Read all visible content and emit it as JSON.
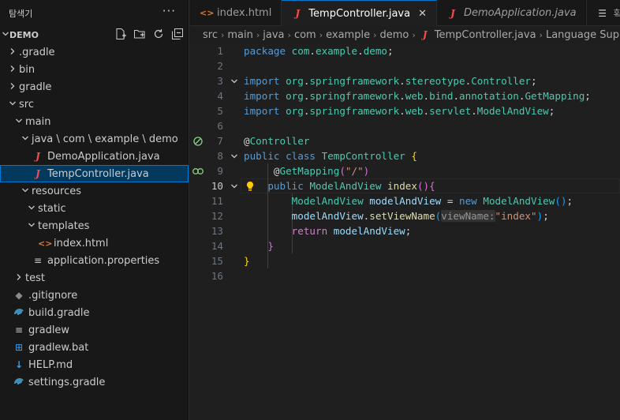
{
  "sidebar": {
    "title": "탐색기",
    "more": "···",
    "project": "DEMO",
    "tree": [
      {
        "label": ".gradle",
        "kind": "folder",
        "level": 0,
        "open": false
      },
      {
        "label": "bin",
        "kind": "folder",
        "level": 0,
        "open": false
      },
      {
        "label": "gradle",
        "kind": "folder",
        "level": 0,
        "open": false
      },
      {
        "label": "src",
        "kind": "folder",
        "level": 0,
        "open": true
      },
      {
        "label": "main",
        "kind": "folder",
        "level": 1,
        "open": true
      },
      {
        "label": "java \\ com \\ example \\ demo",
        "kind": "folder",
        "level": 2,
        "open": true
      },
      {
        "label": "DemoApplication.java",
        "kind": "java",
        "level": 3
      },
      {
        "label": "TempController.java",
        "kind": "java",
        "level": 3,
        "selected": true
      },
      {
        "label": "resources",
        "kind": "folder",
        "level": 2,
        "open": true
      },
      {
        "label": "static",
        "kind": "folder",
        "level": 3,
        "open": true
      },
      {
        "label": "templates",
        "kind": "folder",
        "level": 3,
        "open": true
      },
      {
        "label": "index.html",
        "kind": "html",
        "level": 4
      },
      {
        "label": "application.properties",
        "kind": "props",
        "level": 3
      },
      {
        "label": "test",
        "kind": "folder",
        "level": 1,
        "open": false
      },
      {
        "label": ".gitignore",
        "kind": "git",
        "level": 0
      },
      {
        "label": "build.gradle",
        "kind": "gradle",
        "level": 0
      },
      {
        "label": "gradlew",
        "kind": "plain",
        "level": 0
      },
      {
        "label": "gradlew.bat",
        "kind": "win",
        "level": 0
      },
      {
        "label": "HELP.md",
        "kind": "md",
        "level": 0
      },
      {
        "label": "settings.gradle",
        "kind": "gradle",
        "level": 0
      }
    ]
  },
  "tabs": [
    {
      "label": "index.html",
      "kind": "html",
      "active": false
    },
    {
      "label": "TempController.java",
      "kind": "java",
      "active": true,
      "close": "✕"
    },
    {
      "label": "DemoApplication.java",
      "kind": "java",
      "active": false,
      "italic": true
    },
    {
      "label": "확장:",
      "kind": "ext",
      "active": false
    }
  ],
  "breadcrumb": [
    "src",
    "main",
    "java",
    "com",
    "example",
    "demo",
    "TempController.java",
    "Language Support"
  ],
  "editor": {
    "current_line": 10,
    "lines": [
      {
        "n": "1",
        "tokens": [
          [
            "kw",
            "package"
          ],
          [
            "pl",
            " "
          ],
          [
            "ty",
            "com"
          ],
          [
            "pl",
            "."
          ],
          [
            "ty",
            "example"
          ],
          [
            "pl",
            "."
          ],
          [
            "ty",
            "demo"
          ],
          [
            "pl",
            ";"
          ]
        ]
      },
      {
        "n": "2",
        "tokens": []
      },
      {
        "n": "3",
        "fold": true,
        "tokens": [
          [
            "kw",
            "import"
          ],
          [
            "pl",
            " "
          ],
          [
            "ty",
            "org"
          ],
          [
            "pl",
            "."
          ],
          [
            "ty",
            "springframework"
          ],
          [
            "pl",
            "."
          ],
          [
            "ty",
            "stereotype"
          ],
          [
            "pl",
            "."
          ],
          [
            "ty",
            "Controller"
          ],
          [
            "pl",
            ";"
          ]
        ]
      },
      {
        "n": "4",
        "tokens": [
          [
            "kw",
            "import"
          ],
          [
            "pl",
            " "
          ],
          [
            "ty",
            "org"
          ],
          [
            "pl",
            "."
          ],
          [
            "ty",
            "springframework"
          ],
          [
            "pl",
            "."
          ],
          [
            "ty",
            "web"
          ],
          [
            "pl",
            "."
          ],
          [
            "ty",
            "bind"
          ],
          [
            "pl",
            "."
          ],
          [
            "ty",
            "annotation"
          ],
          [
            "pl",
            "."
          ],
          [
            "ty",
            "GetMapping"
          ],
          [
            "pl",
            ";"
          ]
        ]
      },
      {
        "n": "5",
        "tokens": [
          [
            "kw",
            "import"
          ],
          [
            "pl",
            " "
          ],
          [
            "ty",
            "org"
          ],
          [
            "pl",
            "."
          ],
          [
            "ty",
            "springframework"
          ],
          [
            "pl",
            "."
          ],
          [
            "ty",
            "web"
          ],
          [
            "pl",
            "."
          ],
          [
            "ty",
            "servlet"
          ],
          [
            "pl",
            "."
          ],
          [
            "ty",
            "ModelAndView"
          ],
          [
            "pl",
            ";"
          ]
        ]
      },
      {
        "n": "6",
        "tokens": []
      },
      {
        "n": "7",
        "glyph": "bean-icon",
        "tokens": [
          [
            "pl",
            "@"
          ],
          [
            "ty",
            "Controller"
          ]
        ]
      },
      {
        "n": "8",
        "fold": true,
        "tokens": [
          [
            "kw",
            "public"
          ],
          [
            "pl",
            " "
          ],
          [
            "kw",
            "class"
          ],
          [
            "pl",
            " "
          ],
          [
            "ty",
            "TempController"
          ],
          [
            "pl",
            " "
          ],
          [
            "brk1",
            "{"
          ]
        ]
      },
      {
        "n": "9",
        "glyph": "mapping-icon",
        "tokens": [
          [
            "pl",
            "     @"
          ],
          [
            "ty",
            "GetMapping"
          ],
          [
            "brk2",
            "("
          ],
          [
            "str",
            "\"/\""
          ],
          [
            "brk2",
            ")"
          ]
        ]
      },
      {
        "n": "10",
        "fold": true,
        "bulb": true,
        "tokens": [
          [
            "pl",
            "    "
          ],
          [
            "kw",
            "public"
          ],
          [
            "pl",
            " "
          ],
          [
            "ty",
            "ModelAndView"
          ],
          [
            "pl",
            " "
          ],
          [
            "fn",
            "index"
          ],
          [
            "brk2",
            "()"
          ],
          [
            "brk2",
            "{"
          ]
        ]
      },
      {
        "n": "11",
        "tokens": [
          [
            "pl",
            "        "
          ],
          [
            "ty",
            "ModelAndView"
          ],
          [
            "pl",
            " "
          ],
          [
            "var",
            "modelAndView"
          ],
          [
            "pl",
            " = "
          ],
          [
            "kw",
            "new"
          ],
          [
            "pl",
            " "
          ],
          [
            "ty",
            "ModelAndView"
          ],
          [
            "brk3",
            "()"
          ],
          [
            "pl",
            ";"
          ]
        ]
      },
      {
        "n": "12",
        "tokens": [
          [
            "pl",
            "        "
          ],
          [
            "var",
            "modelAndView"
          ],
          [
            "pl",
            "."
          ],
          [
            "fn",
            "setViewName"
          ],
          [
            "brk3",
            "("
          ],
          [
            "hint",
            "viewName:"
          ],
          [
            "str",
            "\"index\""
          ],
          [
            "brk3",
            ")"
          ],
          [
            "pl",
            ";"
          ]
        ]
      },
      {
        "n": "13",
        "tokens": [
          [
            "pl",
            "        "
          ],
          [
            "ctl",
            "return"
          ],
          [
            "pl",
            " "
          ],
          [
            "var",
            "modelAndView"
          ],
          [
            "pl",
            ";"
          ]
        ]
      },
      {
        "n": "14",
        "tokens": [
          [
            "pl",
            "    "
          ],
          [
            "brk2",
            "}"
          ]
        ]
      },
      {
        "n": "15",
        "tokens": [
          [
            "brk1",
            "}"
          ]
        ]
      },
      {
        "n": "16",
        "tokens": []
      }
    ]
  }
}
